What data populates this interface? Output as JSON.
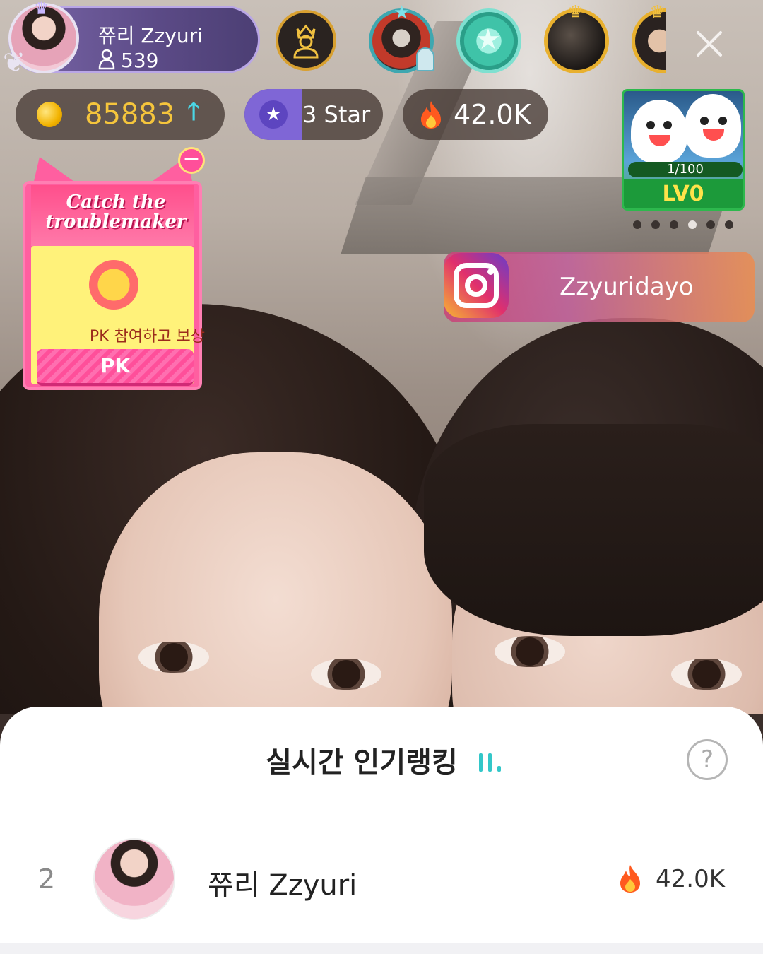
{
  "host": {
    "name": "쮸리 Zzyuri",
    "follower_count": "539"
  },
  "viewers": [
    {
      "icon": "viewer-avatar-singer"
    },
    {
      "icon": "viewer-badge-star"
    },
    {
      "icon": "viewer-avatar-dark"
    },
    {
      "icon": "viewer-avatar-glasses"
    }
  ],
  "stats": {
    "coins": "85883",
    "star_level": "3 Star",
    "popularity": "42.0K"
  },
  "game_widget": {
    "progress": "1/100",
    "level": "LV0",
    "page_count": 6,
    "active_page": 4
  },
  "instagram": {
    "handle": "Zzyuridayo"
  },
  "event": {
    "title_line1": "Catch the",
    "title_line2": "troublemaker",
    "description": "PK 참여하고 보상",
    "button_label": "PK"
  },
  "ranking_sheet": {
    "title": "실시간 인기랭킹",
    "entries": [
      {
        "rank": "2",
        "name": "쮸리 Zzyuri",
        "score": "42.0K"
      }
    ]
  },
  "colors": {
    "coin": "#f5c53c",
    "accent_cyan": "#4ad7e6",
    "event_pink": "#ff5fa0",
    "game_green": "#1c9a3a"
  }
}
